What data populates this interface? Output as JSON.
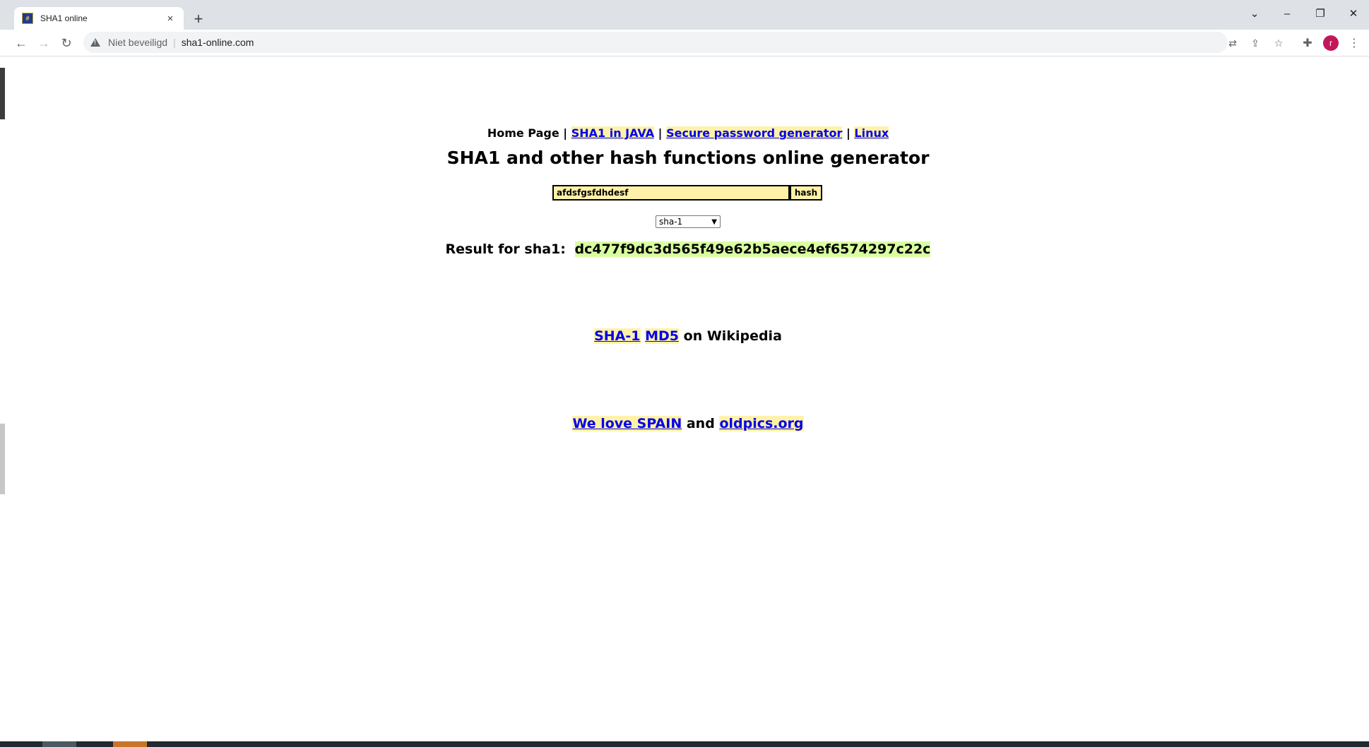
{
  "browser": {
    "tab": {
      "title": "SHA1 online",
      "favicon": "sha1-favicon-icon",
      "close": "×"
    },
    "new_tab": "+",
    "window_controls": {
      "tab_search": "⌄",
      "minimize": "–",
      "restore": "❐",
      "close": "✕"
    },
    "nav": {
      "back": "←",
      "forward": "→",
      "reload": "↻"
    },
    "address": {
      "security_label": "Niet beveiligd",
      "url": "sha1-online.com"
    },
    "omnibox_icons": {
      "translate": "⇄",
      "share": "⇪",
      "bookmark": "☆"
    },
    "extensions": "✚",
    "profile_initial": "r",
    "menu": "⋮"
  },
  "page": {
    "nav": {
      "home": "Home Page",
      "sep": "|",
      "links": [
        "SHA1 in JAVA",
        "Secure password generator",
        "Linux"
      ]
    },
    "title": "SHA1 and other hash functions online generator",
    "form": {
      "input_value": "afdsfgsfdhdesf",
      "button_label": "hash",
      "algorithm": "sha-1"
    },
    "result": {
      "label": "Result for sha1:",
      "hash": "dc477f9dc3d565f49e62b5aece4ef6574297c22c"
    },
    "wiki": {
      "link1": "SHA-1",
      "link2": "MD5",
      "suffix": "on Wikipedia"
    },
    "promo": {
      "link1": "We love SPAIN",
      "conj": "and",
      "link2": "oldpics.org"
    }
  },
  "colors": {
    "link_highlight": "#fff2a8",
    "hash_highlight": "#d8ffa0",
    "link": "#0000ee"
  }
}
